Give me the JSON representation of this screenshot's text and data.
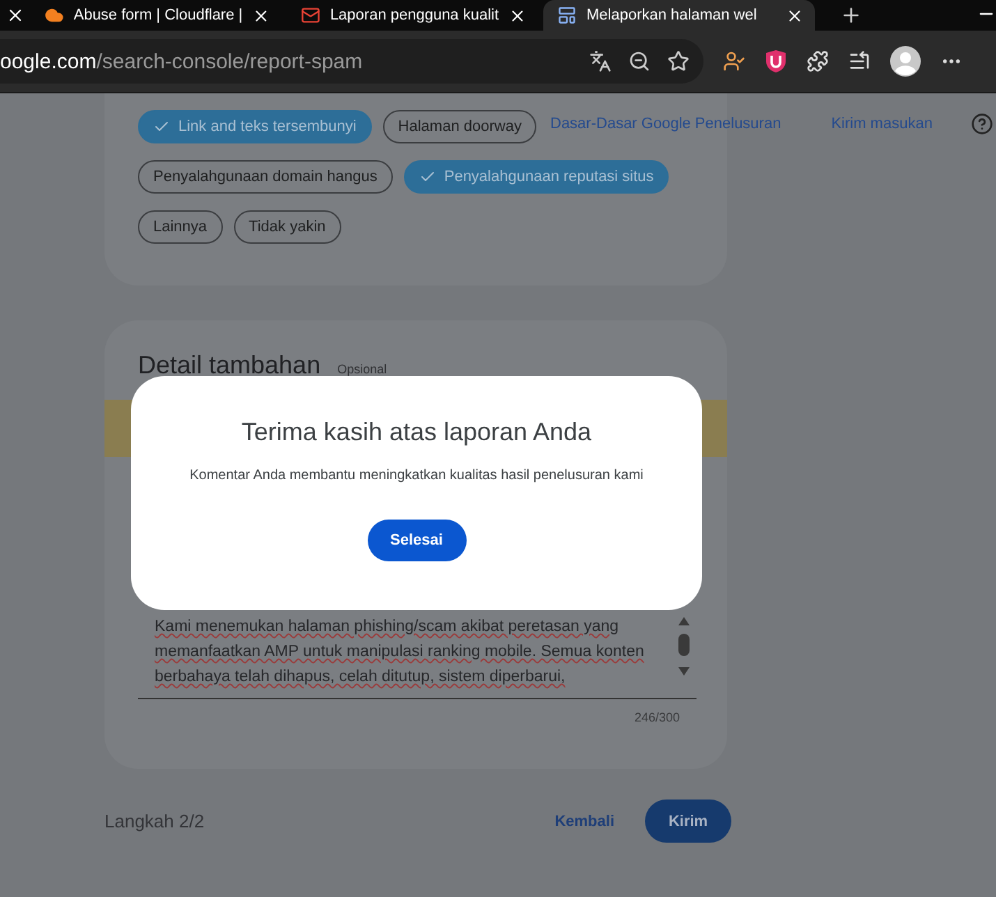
{
  "browser": {
    "tabs": [
      {
        "title": "Abuse form | Cloudflare |",
        "kind": "cloudflare",
        "selected": false
      },
      {
        "title": "Laporan pengguna kualit",
        "kind": "mail",
        "selected": false
      },
      {
        "title": "Melaporkan halaman wel",
        "kind": "page",
        "selected": true
      }
    ],
    "address": {
      "host": "oogle.com",
      "path": "/search-console/report-spam"
    }
  },
  "header_links": [
    "Dasar-Dasar Google Penelusuran",
    "Kirim masukan"
  ],
  "chips": [
    [
      {
        "label": "Link and teks tersembunyi",
        "selected": true
      },
      {
        "label": "Halaman doorway",
        "selected": false
      }
    ],
    [
      {
        "label": "Penyalahgunaan domain hangus",
        "selected": false
      },
      {
        "label": "Penyalahgunaan reputasi situs",
        "selected": true
      }
    ],
    [
      {
        "label": "Lainnya",
        "selected": false
      },
      {
        "label": "Tidak yakin",
        "selected": false
      }
    ]
  ],
  "details": {
    "title": "Detail tambahan",
    "optional": "Opsional",
    "text": "Kami menemukan halaman phishing/scam akibat peretasan yang memanfaatkan AMP untuk manipulasi ranking mobile. Semua konten berbahaya telah dihapus, celah ditutup, sistem diperbarui,",
    "counter": "246/300"
  },
  "footer": {
    "step": "Langkah 2/2",
    "back": "Kembali",
    "submit": "Kirim"
  },
  "dialog": {
    "title": "Terima kasih atas laporan Anda",
    "message": "Komentar Anda membantu meningkatkan kualitas hasil penelusuran kami",
    "button": "Selesai"
  }
}
